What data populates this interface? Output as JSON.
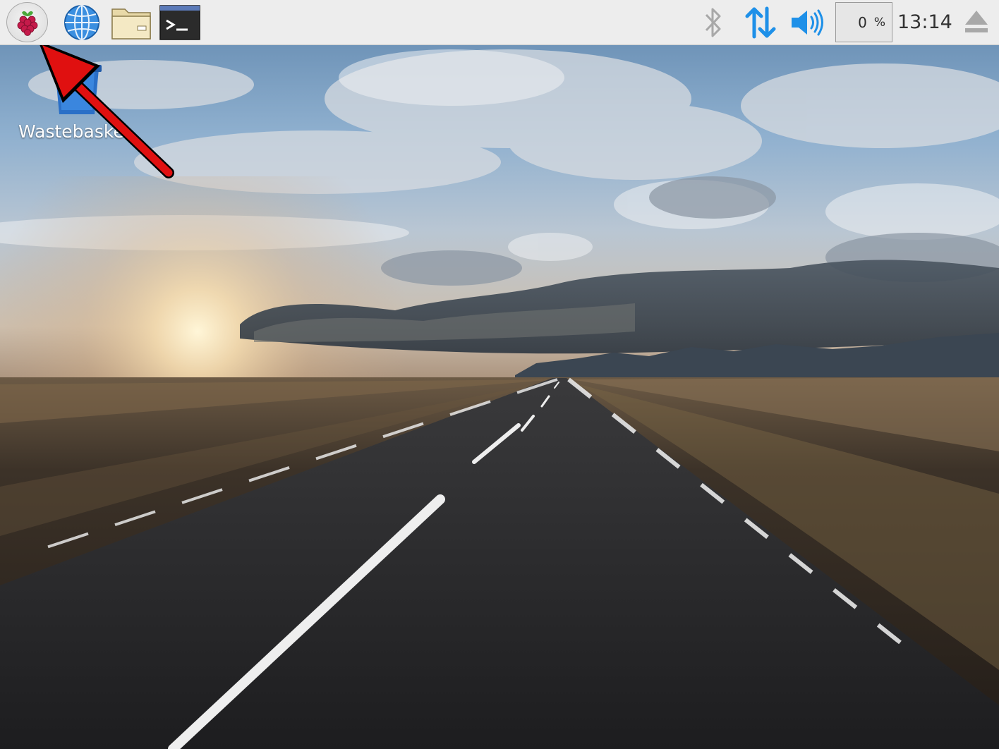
{
  "taskbar": {
    "menu_button": {
      "icon": "raspberry-icon"
    },
    "launchers": [
      {
        "name": "web-browser",
        "icon": "globe-icon"
      },
      {
        "name": "file-manager",
        "icon": "folder-icon"
      },
      {
        "name": "terminal",
        "icon": "terminal-icon",
        "glyph": ">_"
      }
    ],
    "tray": {
      "bluetooth_icon": "bluetooth-icon",
      "network_icon": "network-arrows-icon",
      "volume_icon": "speaker-icon",
      "cpu_value": "0",
      "cpu_unit": "%",
      "clock": "13:14",
      "eject_icon": "eject-icon"
    }
  },
  "desktop": {
    "icons": [
      {
        "label": "Wastebasket",
        "icon": "trash-icon"
      }
    ],
    "annotation": {
      "type": "arrow",
      "color": "#e01010",
      "points_to": "menu-button"
    }
  },
  "colors": {
    "taskbar_bg": "#ededed",
    "tray_accent": "#1e90e8",
    "annotation_red": "#e01010"
  }
}
